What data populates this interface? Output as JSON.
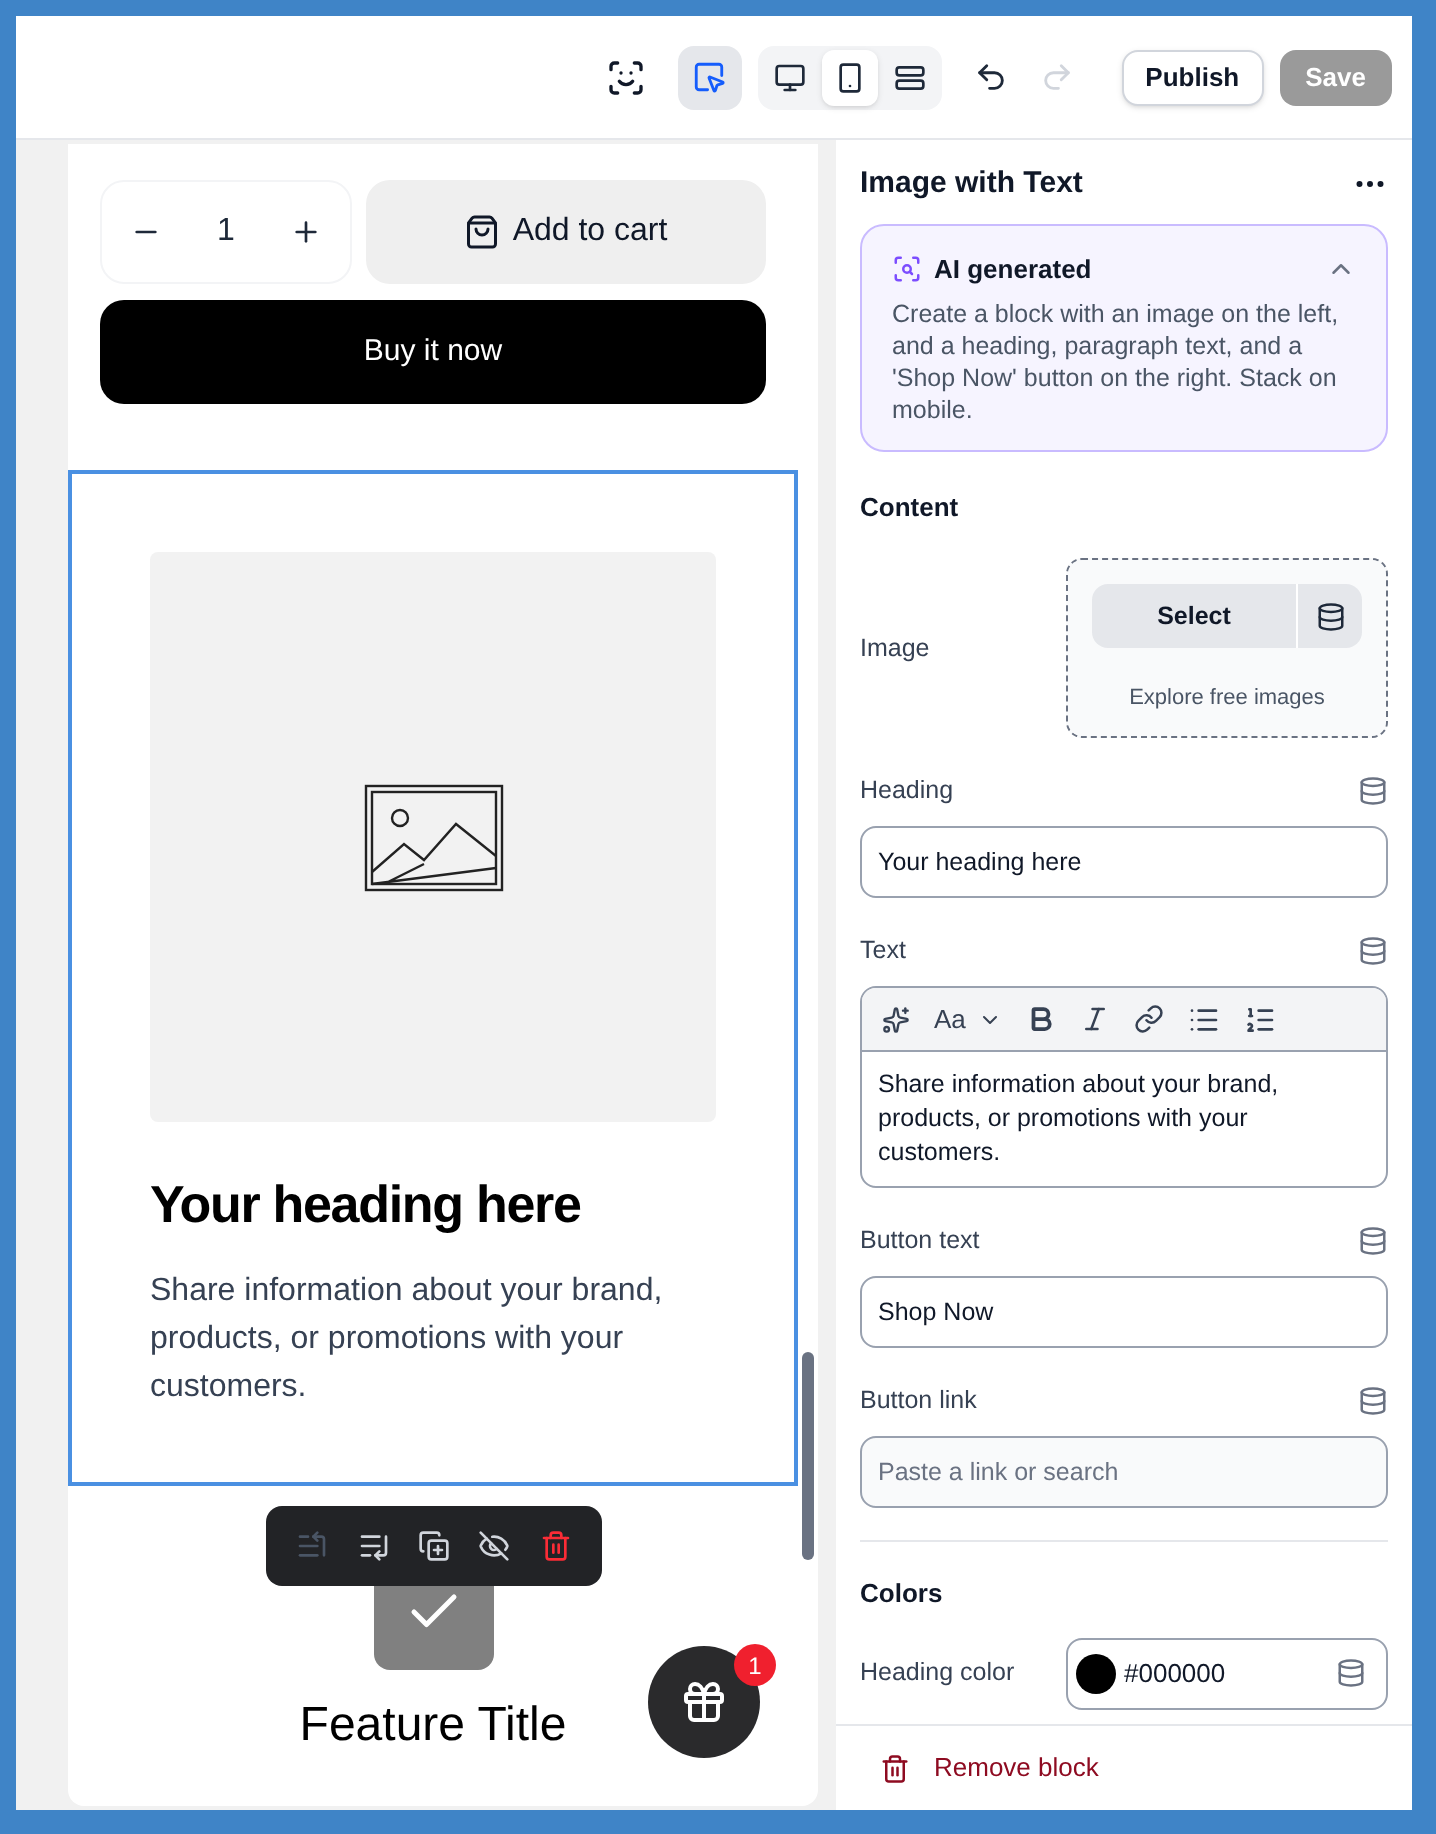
{
  "toolbar": {
    "tools": [
      {
        "kind": "inspect",
        "selected": true
      }
    ],
    "views": [
      {
        "kind": "desktop",
        "selected": false
      },
      {
        "kind": "mobile",
        "selected": true
      },
      {
        "kind": "fullwidth",
        "selected": false
      }
    ],
    "redo_disabled": true,
    "publish": "Publish",
    "save": {
      "label": "Save",
      "disabled": true
    }
  },
  "preview": {
    "quantity": "1",
    "add_to_cart": "Add to cart",
    "buy_now": "Buy it now",
    "section": {
      "heading": "Your heading here",
      "text": "Share information about your brand, products, or promotions with your customers.",
      "selected": true
    },
    "block_actions": [
      {
        "kind": "move-up",
        "disabled": true
      },
      {
        "kind": "move-down",
        "disabled": false
      },
      {
        "kind": "duplicate",
        "disabled": false
      },
      {
        "kind": "hide",
        "disabled": false
      },
      {
        "kind": "delete"
      }
    ],
    "feature": {
      "title": "Feature Title"
    },
    "gift_badge": "1"
  },
  "panel": {
    "title": "Image with Text",
    "ai": {
      "title": "AI generated",
      "expanded": true,
      "text": "Create a block with an image on the left, and a heading, paragraph text, and a 'Shop Now' button on the right. Stack on mobile."
    },
    "content_title": "Content",
    "image": {
      "label": "Image",
      "select": "Select",
      "explore": "Explore free images"
    },
    "fields": [
      {
        "label": "Heading",
        "kind": "input",
        "value": "Your heading here"
      },
      {
        "label": "Text",
        "kind": "richtext",
        "value": "Share information about your brand, products, or promotions with your customers.",
        "font_button": "Aa"
      },
      {
        "label": "Button text",
        "kind": "input",
        "value": "Shop Now"
      },
      {
        "label": "Button link",
        "kind": "input",
        "placeholder": "Paste a link or search"
      }
    ],
    "colors_title": "Colors",
    "colors": [
      {
        "label": "Heading color",
        "value": "#000000",
        "color": "#000000"
      }
    ],
    "remove": "Remove block"
  }
}
